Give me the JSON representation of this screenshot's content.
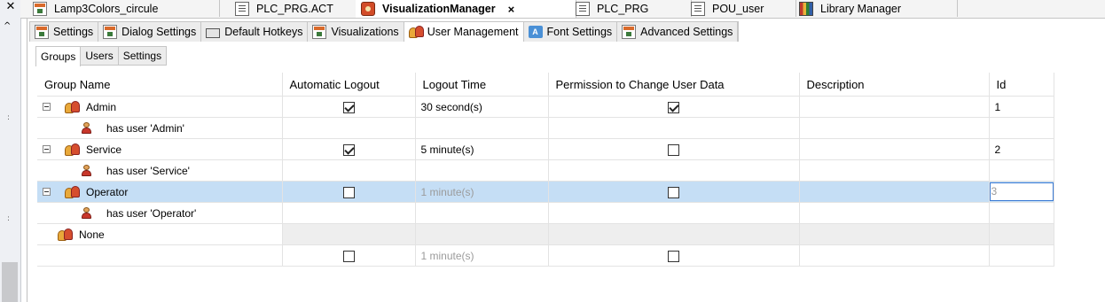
{
  "editor_tabs": [
    {
      "label": "Lamp3Colors_circule",
      "icon": "window-icon"
    },
    {
      "label": "PLC_PRG.ACT",
      "icon": "action-icon"
    },
    {
      "label": "VisualizationManager",
      "icon": "visualization-manager-icon",
      "active": true,
      "close": "×"
    },
    {
      "label": "PLC_PRG",
      "icon": "document-icon"
    },
    {
      "label": "POU_user",
      "icon": "document-icon"
    },
    {
      "label": "Library Manager",
      "icon": "library-icon"
    }
  ],
  "settings_tabs": [
    {
      "label": "Settings"
    },
    {
      "label": "Dialog Settings"
    },
    {
      "label": "Default Hotkeys"
    },
    {
      "label": "Visualizations"
    },
    {
      "label": "User Management",
      "active": true
    },
    {
      "label": "Font Settings"
    },
    {
      "label": "Advanced Settings"
    }
  ],
  "sub_tabs": [
    {
      "label": "Groups",
      "active": true
    },
    {
      "label": "Users"
    },
    {
      "label": "Settings"
    }
  ],
  "table": {
    "columns": [
      "Group Name",
      "Automatic Logout",
      "Logout Time",
      "Permission to Change User Data",
      "Description",
      "Id"
    ],
    "rows": [
      {
        "kind": "group",
        "name": "Admin",
        "auto_logout": true,
        "logout_time": "30 second(s)",
        "permission": true,
        "description": "",
        "id": "1"
      },
      {
        "kind": "user",
        "name": "has user 'Admin'"
      },
      {
        "kind": "group",
        "name": "Service",
        "auto_logout": true,
        "logout_time": "5 minute(s)",
        "permission": false,
        "description": "",
        "id": "2"
      },
      {
        "kind": "user",
        "name": "has user 'Service'"
      },
      {
        "kind": "group",
        "name": "Operator",
        "auto_logout": false,
        "logout_time": "1 minute(s)",
        "permission": false,
        "description": "",
        "id": "3",
        "selected": true
      },
      {
        "kind": "user",
        "name": "has user 'Operator'"
      },
      {
        "kind": "none",
        "name": "None"
      },
      {
        "kind": "new",
        "name": "",
        "auto_logout": false,
        "logout_time": "1 minute(s)",
        "permission": false
      }
    ]
  },
  "left_panel": {
    "close_glyph": "✕",
    "scroll_up_glyph": "^"
  },
  "colors": {
    "selection": "#c5def5",
    "edit_border": "#3b7bd4",
    "disabled_text": "#9b9b9b"
  }
}
